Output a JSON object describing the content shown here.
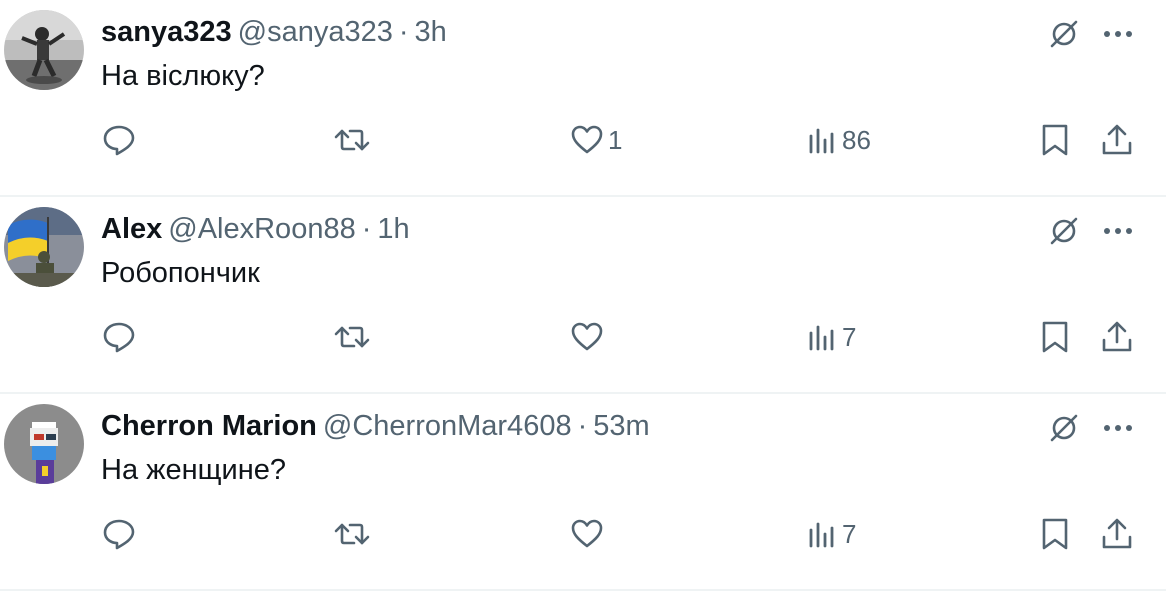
{
  "tweets": [
    {
      "name": "sanya323",
      "handle": "@sanya323",
      "dot": "·",
      "time": "3h",
      "text": "На віслюку?",
      "likes": "1",
      "views": "86",
      "avatar": "bw-photo-avatar"
    },
    {
      "name": "Alex",
      "handle": "@AlexRoon88",
      "dot": "·",
      "time": "1h",
      "text": "Робопончик",
      "likes": "",
      "views": "7",
      "avatar": "ukraine-flag-avatar"
    },
    {
      "name": "Cherron Marion",
      "handle": "@CherronMar4608",
      "dot": "·",
      "time": "53m",
      "text": "На женщине?",
      "likes": "",
      "views": "7",
      "avatar": "pixel-punk-avatar"
    }
  ],
  "icons": {
    "reply": "reply-icon",
    "retweet": "retweet-icon",
    "like": "heart-icon",
    "views": "views-icon",
    "bookmark": "bookmark-icon",
    "share": "share-icon",
    "grok": "grok-icon",
    "more": "more-icon"
  },
  "colors": {
    "text": "#0f1419",
    "secondary": "#536471",
    "divider": "#eff3f4"
  }
}
